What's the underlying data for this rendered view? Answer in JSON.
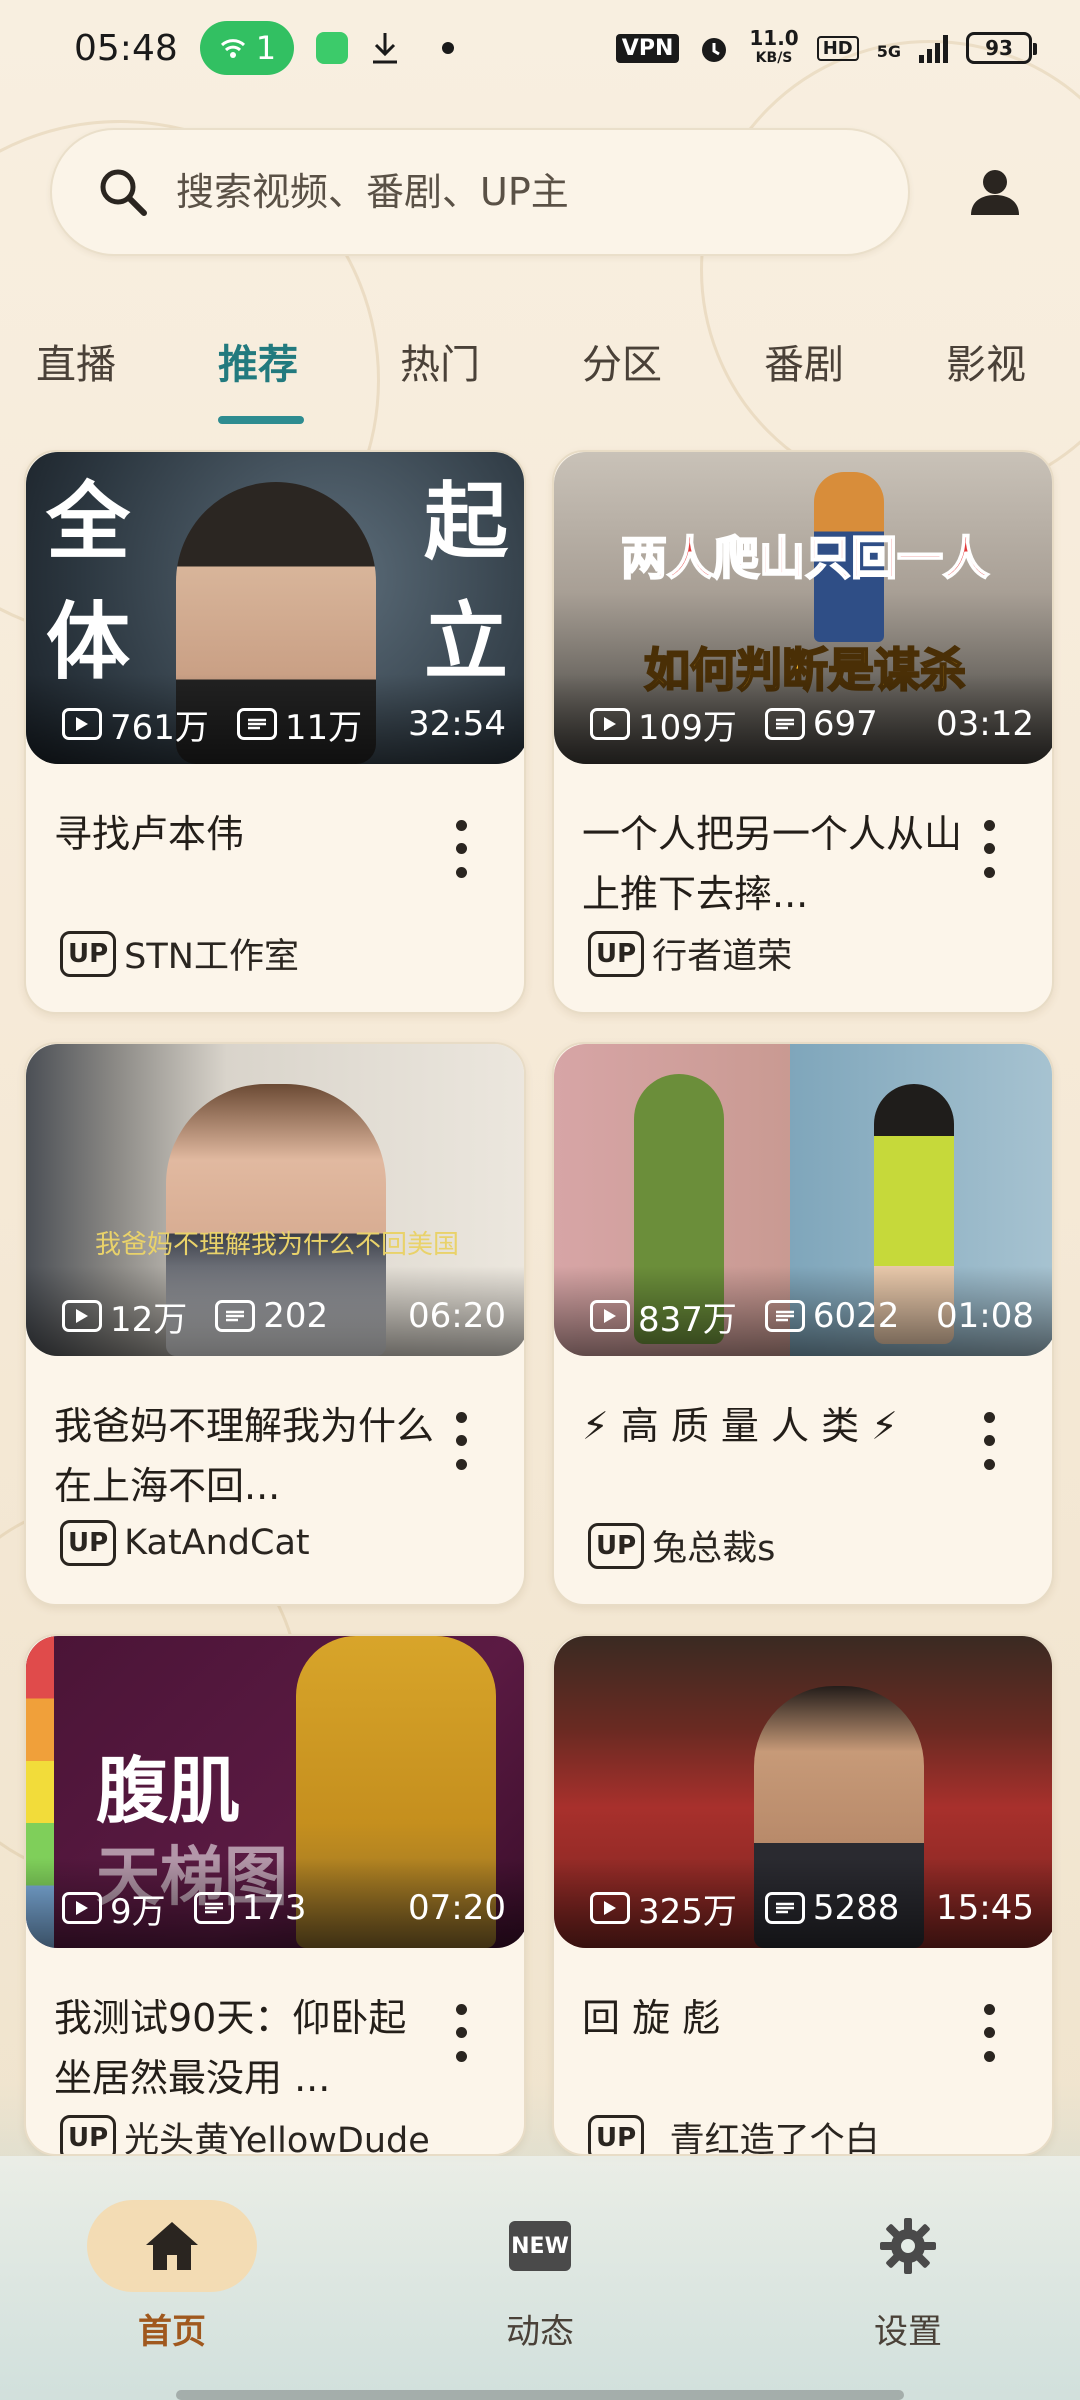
{
  "status_bar": {
    "time": "05:48",
    "hotspot_count": "1",
    "vpn": "VPN",
    "speed_value": "11.0",
    "speed_unit": "KB/S",
    "hd": "HD",
    "network": "5G",
    "battery": "93"
  },
  "search": {
    "placeholder": "搜索视频、番剧、UP主"
  },
  "tabs": [
    "直播",
    "推荐",
    "热门",
    "分区",
    "番剧",
    "影视"
  ],
  "active_tab": "推荐",
  "cards": [
    {
      "title": "寻找卢本伟",
      "uploader": "STN工作室",
      "views": "761万",
      "danmaku": "11万",
      "duration": "32:54",
      "thumb_text_left": "全\n体",
      "thumb_text_right": "起\n立"
    },
    {
      "title": "一个人把另一个人从山上推下去摔...",
      "uploader": "行者道荣",
      "views": "109万",
      "danmaku": "697",
      "duration": "03:12",
      "thumb_text_top": "两人爬山只回一人",
      "thumb_text_bottom": "如何判断是谋杀"
    },
    {
      "title": "我爸妈不理解我为什么在上海不回...",
      "uploader": "KatAndCat",
      "views": "12万",
      "danmaku": "202",
      "duration": "06:20",
      "thumb_caption": "我爸妈不理解我为什么不回美国"
    },
    {
      "title": "⚡ 高 质 量 人 类 ⚡",
      "uploader": "兔总裁s",
      "views": "837万",
      "danmaku": "6022",
      "duration": "01:08"
    },
    {
      "title": "我测试90天：仰卧起坐居然最没用 ...",
      "uploader": "光头黄YellowDude",
      "views": "9万",
      "danmaku": "173",
      "duration": "07:20",
      "thumb_text_top": "腹肌",
      "thumb_text_bottom": "天梯图"
    },
    {
      "title": "回 旋 彪",
      "uploader": "_青红造了个白_",
      "views": "325万",
      "danmaku": "5288",
      "duration": "15:45"
    }
  ],
  "up_badge": "UP",
  "bottom_nav": [
    {
      "label": "首页",
      "icon": "home-icon",
      "active": true
    },
    {
      "label": "动态",
      "icon": "new-badge-icon",
      "active": false
    },
    {
      "label": "设置",
      "icon": "gear-icon",
      "active": false
    }
  ],
  "new_badge_text": "NEW",
  "colors": {
    "accent": "#227a7e",
    "nav_active": "#a0581e",
    "nav_pill": "#f3dcb4",
    "hotspot": "#32c062"
  }
}
